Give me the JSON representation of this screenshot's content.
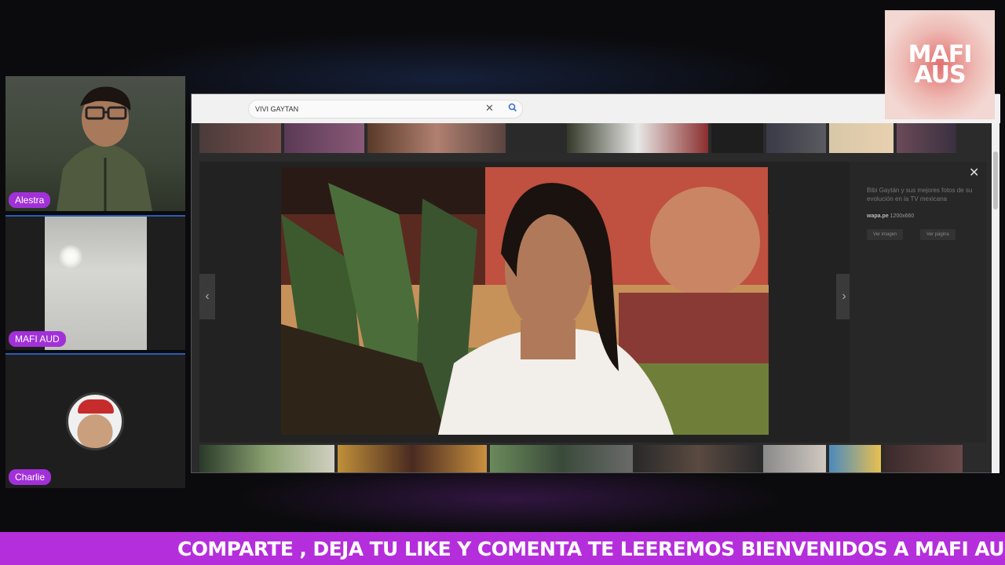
{
  "participants": [
    {
      "name": "Alestra"
    },
    {
      "name": "MAFI AUD"
    },
    {
      "name": "Charlie"
    }
  ],
  "browser": {
    "search": {
      "value": "VIVI GAYTAN"
    },
    "image_panel": {
      "title": "Bibi Gaytán y sus mejores fotos de su evolución en la TV mexicana",
      "source_site": "wapa.pe",
      "dimensions": "1200x660",
      "view_image_label": "Ver imagen",
      "visit_page_label": "Ver página"
    }
  },
  "logo": {
    "line1": "MAFI",
    "line2": "AUS"
  },
  "banner": {
    "text": "COMPARTE , DEJA TU LIKE Y COMENTA TE LEEREMOS BIENVENIDOS A MAFI AUS..."
  },
  "icons": [
    "search-icon",
    "close-icon",
    "chevron-left-icon",
    "chevron-right-icon"
  ],
  "colors": {
    "accent": "#a230d8",
    "banner": "#b52edb"
  }
}
